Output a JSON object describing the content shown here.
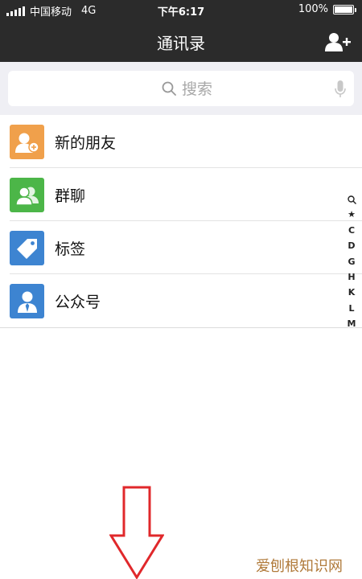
{
  "status_bar": {
    "carrier": "中国移动",
    "network": "4G",
    "time": "下午6:17",
    "battery": "100%"
  },
  "nav": {
    "title": "通讯录",
    "add_icon": "add-contact-icon"
  },
  "search": {
    "placeholder": "搜索",
    "icon": "search-icon",
    "mic_icon": "microphone-icon"
  },
  "contacts": {
    "items": [
      {
        "label": "新的朋友",
        "icon": "new-friend-icon",
        "color": "#f0a04b"
      },
      {
        "label": "群聊",
        "icon": "group-chat-icon",
        "color": "#4cb648"
      },
      {
        "label": "标签",
        "icon": "tag-icon",
        "color": "#3d84d1"
      },
      {
        "label": "公众号",
        "icon": "official-account-icon",
        "color": "#3d84d1"
      }
    ]
  },
  "index_bar": {
    "letters": [
      "★",
      "C",
      "D",
      "G",
      "H",
      "K",
      "L",
      "M"
    ]
  },
  "watermark": "爱刨根知识网",
  "colors": {
    "header_bg": "#2b2b2b",
    "page_bg": "#efeff4",
    "arrow": "#e0282b"
  }
}
